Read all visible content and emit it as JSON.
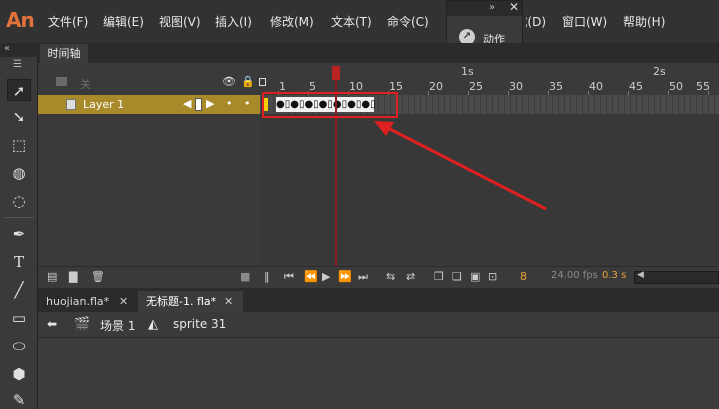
{
  "app": {
    "logo": "An"
  },
  "menu": [
    "文件(F)",
    "编辑(E)",
    "视图(V)",
    "插入(I)",
    "修改(M)",
    "文本(T)",
    "命令(C)",
    "调试(D)",
    "窗口(W)",
    "帮助(H)"
  ],
  "action_panel": {
    "title_arrows": "»",
    "close": "✕",
    "label": "动作"
  },
  "timeline": {
    "tab": "时间轴",
    "header_layer_label": "关",
    "ruler": {
      "frames": [
        "1",
        "5",
        "10",
        "15",
        "20",
        "25",
        "30",
        "35",
        "40",
        "45",
        "50",
        "55"
      ],
      "seconds": [
        "1s",
        "2s"
      ]
    },
    "layer": {
      "name": "Layer 1"
    },
    "keyframes_text": "●▯●▯●▯●▯●▯●▯●▯",
    "controls": {
      "current_frame": "8",
      "fps": "24.00 fps",
      "time": "0.3 s"
    }
  },
  "documents": [
    {
      "name": "huojian.fla*",
      "active": false
    },
    {
      "name": "无标题-1. fla*",
      "active": true
    }
  ],
  "breadcrumb": {
    "scene": "场景 1",
    "symbol": "sprite 31"
  },
  "colors": {
    "accent": "#e0723a",
    "layer_highlight": "#a88a2a",
    "annotation": "#e02020",
    "playhead": "#b22222"
  }
}
